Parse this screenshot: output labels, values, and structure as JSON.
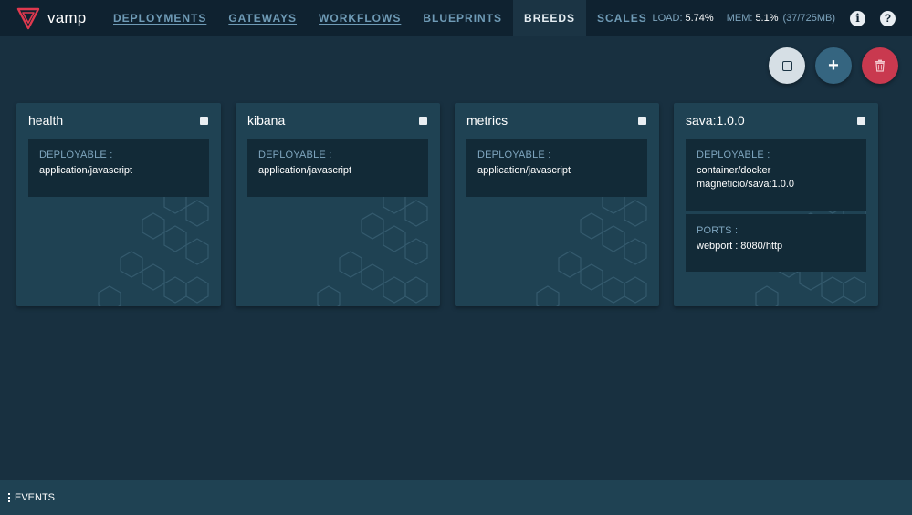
{
  "brand": {
    "name": "vamp"
  },
  "nav": [
    {
      "label": "DEPLOYMENTS",
      "state": "underlined"
    },
    {
      "label": "GATEWAYS",
      "state": "underlined"
    },
    {
      "label": "WORKFLOWS",
      "state": "underlined"
    },
    {
      "label": "BLUEPRINTS",
      "state": "normal"
    },
    {
      "label": "BREEDS",
      "state": "active"
    },
    {
      "label": "SCALES",
      "state": "normal"
    }
  ],
  "stats": {
    "load_label": "LOAD:",
    "load_value": "5.74%",
    "mem_label": "MEM:",
    "mem_value": "5.1%",
    "mem_detail": "(37/725MB)"
  },
  "header_icons": {
    "info": "i",
    "help": "?"
  },
  "actions": {
    "add_glyph": "+"
  },
  "breeds": [
    {
      "name": "health",
      "deployable_label": "DEPLOYABLE :",
      "deployable": [
        "application/javascript"
      ]
    },
    {
      "name": "kibana",
      "deployable_label": "DEPLOYABLE :",
      "deployable": [
        "application/javascript"
      ]
    },
    {
      "name": "metrics",
      "deployable_label": "DEPLOYABLE :",
      "deployable": [
        "application/javascript"
      ]
    },
    {
      "name": "sava:1.0.0",
      "deployable_label": "DEPLOYABLE :",
      "deployable": [
        "container/docker",
        "magneticio/sava:1.0.0"
      ],
      "ports_label": "PORTS :",
      "ports": [
        "webport : 8080/http"
      ]
    }
  ],
  "footer": {
    "label": "EVENTS"
  },
  "colors": {
    "accent": "#c9394f",
    "topbar": "#0f2230",
    "background": "#183040",
    "card": "#1f4253"
  }
}
